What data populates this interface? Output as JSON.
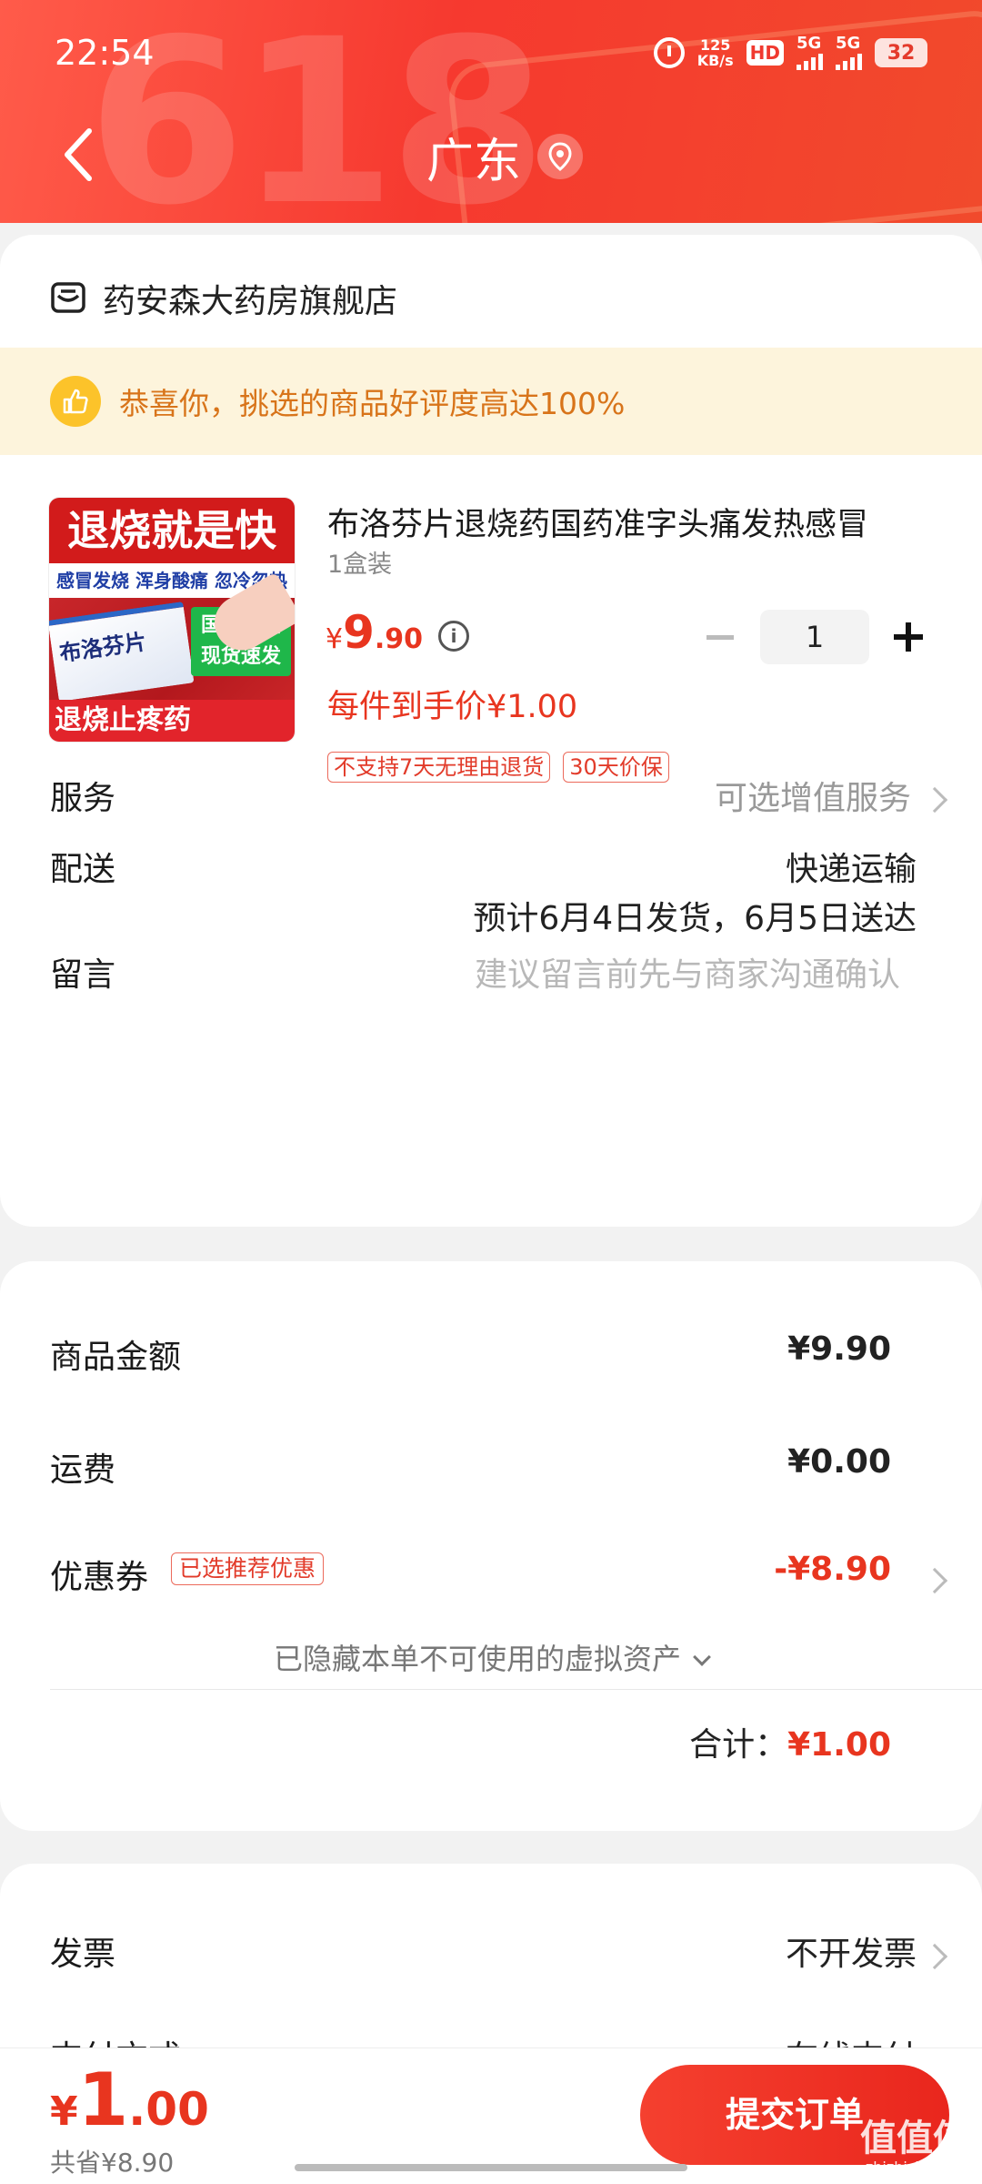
{
  "status_bar": {
    "time": "22:54",
    "net_speed_value": "125",
    "net_speed_unit": "KB/s",
    "hd_label": "HD",
    "sim1_label": "5G",
    "sim2_label": "5G",
    "battery": "32"
  },
  "header": {
    "bg_deco_text": "618",
    "title": "广东"
  },
  "store": {
    "name": "药安森大药房旗舰店"
  },
  "praise_banner": {
    "text": "恭喜你，挑选的商品好评度高达100%"
  },
  "product": {
    "image_text": {
      "top": "退烧就是快",
      "sub": "感冒发烧  浑身酸痛  忽冷忽热",
      "box_name": "布洛芬片",
      "badge_line1": "国药正品",
      "badge_line2": "现货速发",
      "bottom": "退烧止疼药"
    },
    "title": "布洛芬片退烧药国药准字头痛发热感冒",
    "spec": "1盒装",
    "price_currency": "¥",
    "price_int": "9",
    "price_dec": ".90",
    "info_symbol": "i",
    "quantity": "1",
    "final_price": "每件到手价¥1.00",
    "tags": [
      "不支持7天无理由退货",
      "30天价保"
    ]
  },
  "service": {
    "label": "服务",
    "value": "可选增值服务"
  },
  "delivery": {
    "label": "配送",
    "method": "快递运输",
    "estimate": "预计6月4日发货，6月5日送达"
  },
  "message": {
    "label": "留言",
    "placeholder": "建议留言前先与商家沟通确认"
  },
  "summary": {
    "goods_label": "商品金额",
    "goods_value": "¥9.90",
    "shipping_label": "运费",
    "shipping_value": "¥0.00",
    "coupon_label": "优惠券",
    "coupon_tag": "已选推荐优惠",
    "coupon_value": "-¥8.90",
    "hidden_assets": "已隐藏本单不可使用的虚拟资产",
    "total_label": "合计：",
    "total_value": "¥1.00"
  },
  "invoice": {
    "label": "发票",
    "value": "不开发票"
  },
  "payment": {
    "label": "支付方式",
    "value": "在线支付"
  },
  "bottom_bar": {
    "currency": "¥",
    "price_int": "1",
    "price_dec": ".00",
    "saved": "共省¥8.90",
    "submit_label": "提交订单"
  },
  "watermark": {
    "logo": "值值值",
    "domain": "zhizhizhi.com"
  },
  "colors": {
    "accent_red": "#e8351f",
    "header_red": "#f6392f",
    "banner_bg": "#fdf4dc",
    "banner_text": "#d8741a"
  }
}
